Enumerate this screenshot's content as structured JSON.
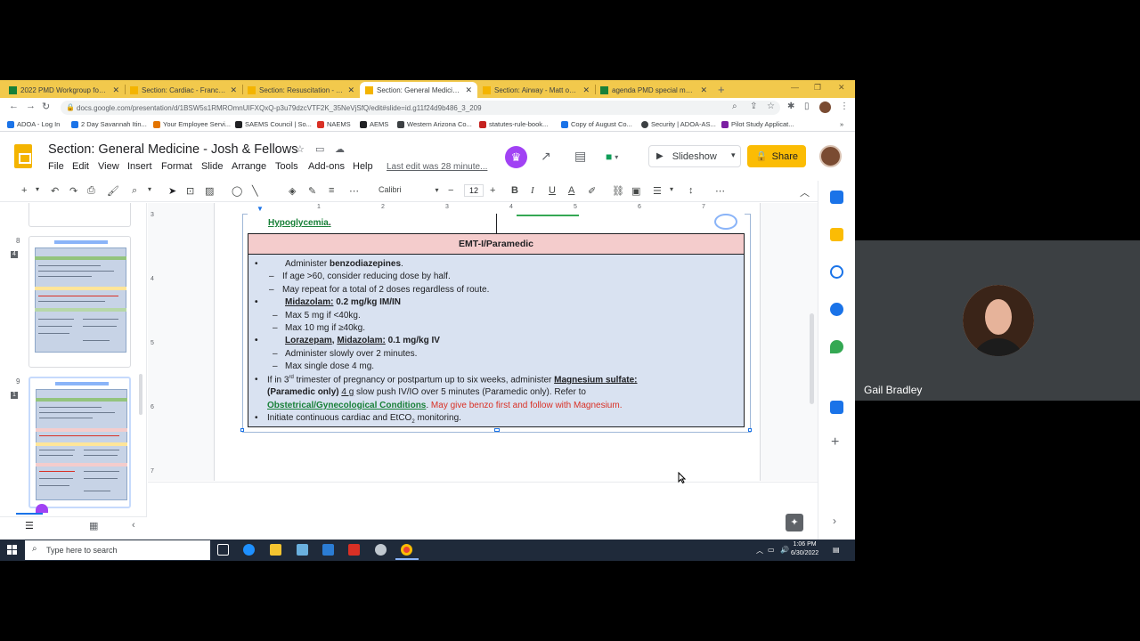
{
  "browser": {
    "tabs": [
      {
        "label": "2022 PMD Workgroup for TT",
        "active": false,
        "color": "#188038"
      },
      {
        "label": "Section: Cardiac - Franco & A",
        "active": false,
        "color": "#f4b400"
      },
      {
        "label": "Section: Resuscitation - Amb",
        "active": false,
        "color": "#f4b400"
      },
      {
        "label": "Section: General Medicine -",
        "active": true,
        "color": "#f4b400"
      },
      {
        "label": "Section: Airway - Matt one le",
        "active": false,
        "color": "#f4b400"
      },
      {
        "label": "agenda PMD special meeting",
        "active": false,
        "color": "#188038"
      }
    ],
    "url": "docs.google.com/presentation/d/1BSW5s1RMROmnUIFXQxQ-p3u79dzcVTF2K_35NeVjSfQ/edit#slide=id.g11f24d9b486_3_209",
    "bookmarks": [
      "ADOA - Log In",
      "2 Day Savannah Itin...",
      "Your Employee Servi...",
      "SAEMS Council | So...",
      "NAEMS",
      "AEMS",
      "Western Arizona Co...",
      "statutes-rule-book...",
      "Copy of August Co...",
      "Security | ADOA-AS...",
      "Pilot Study Applicat..."
    ]
  },
  "app": {
    "title": "Section:  General Medicine - Josh & Fellows",
    "menus": [
      "File",
      "Edit",
      "View",
      "Insert",
      "Format",
      "Slide",
      "Arrange",
      "Tools",
      "Add-ons",
      "Help"
    ],
    "last_edit": "Last edit was 28 minute...",
    "slideshow_label": "Slideshow",
    "share_label": "Share",
    "font": "Calibri",
    "font_size": "12",
    "accent": "#fbbc04"
  },
  "filmstrip": {
    "slides": [
      {
        "num": "8",
        "comments": "4"
      },
      {
        "num": "9",
        "comments": "1"
      }
    ]
  },
  "rulers": {
    "h": [
      "1",
      "2",
      "3",
      "4",
      "5",
      "6",
      "7"
    ],
    "v": [
      "3",
      "4",
      "5",
      "6",
      "7"
    ]
  },
  "slide": {
    "top_link": "Hypoglycemia",
    "top_punct": ".",
    "header": "EMT-I/Paramedic",
    "lines": {
      "l1_pre": "Administer ",
      "l1_bold": "benzodiazepines",
      "l1_post": ".",
      "l2": "If age >60, consider reducing dose by half.",
      "l3": "May repeat for a total of 2 doses regardless of route.",
      "l4_drug": "Midazolam:",
      "l4_dose": " 0.2 mg/kg IM/IN",
      "l5": "Max 5 mg if <40kg.",
      "l6": "Max 10 mg if ≥40kg.",
      "l7_drug1": "Lorazepam",
      "l7_sep": ", ",
      "l7_drug2": "Midazolam:",
      "l7_dose": " 0.1 mg/kg IV",
      "l8": "Administer slowly over 2 minutes.",
      "l9": "Max single dose 4 mg.",
      "l10_a": "If in 3",
      "l10_sup": "rd",
      "l10_b": " trimester of pregnancy or postpartum up to six weeks,  administer ",
      "l10_drug": "Magnesium sulfate:",
      "l11_bold": "(Paramedic only) ",
      "l11_dose": "4 g",
      "l11_rest": " slow push IV/IO over 5 minutes (Paramedic only).  Refer to",
      "l12_link": "Obstetrical/Gynecological Conditions",
      "l12_dot": ".",
      "l12_red": " May give benzo first and follow with Magnesium.",
      "l13_a": "Initiate continuous cardiac and EtCO",
      "l13_sub": "2",
      "l13_b": " monitoring."
    }
  },
  "taskbar": {
    "search_placeholder": "Type here to search",
    "time": "1:06 PM",
    "date": "6/30/2022"
  },
  "participant": {
    "name": "Gail Bradley"
  }
}
